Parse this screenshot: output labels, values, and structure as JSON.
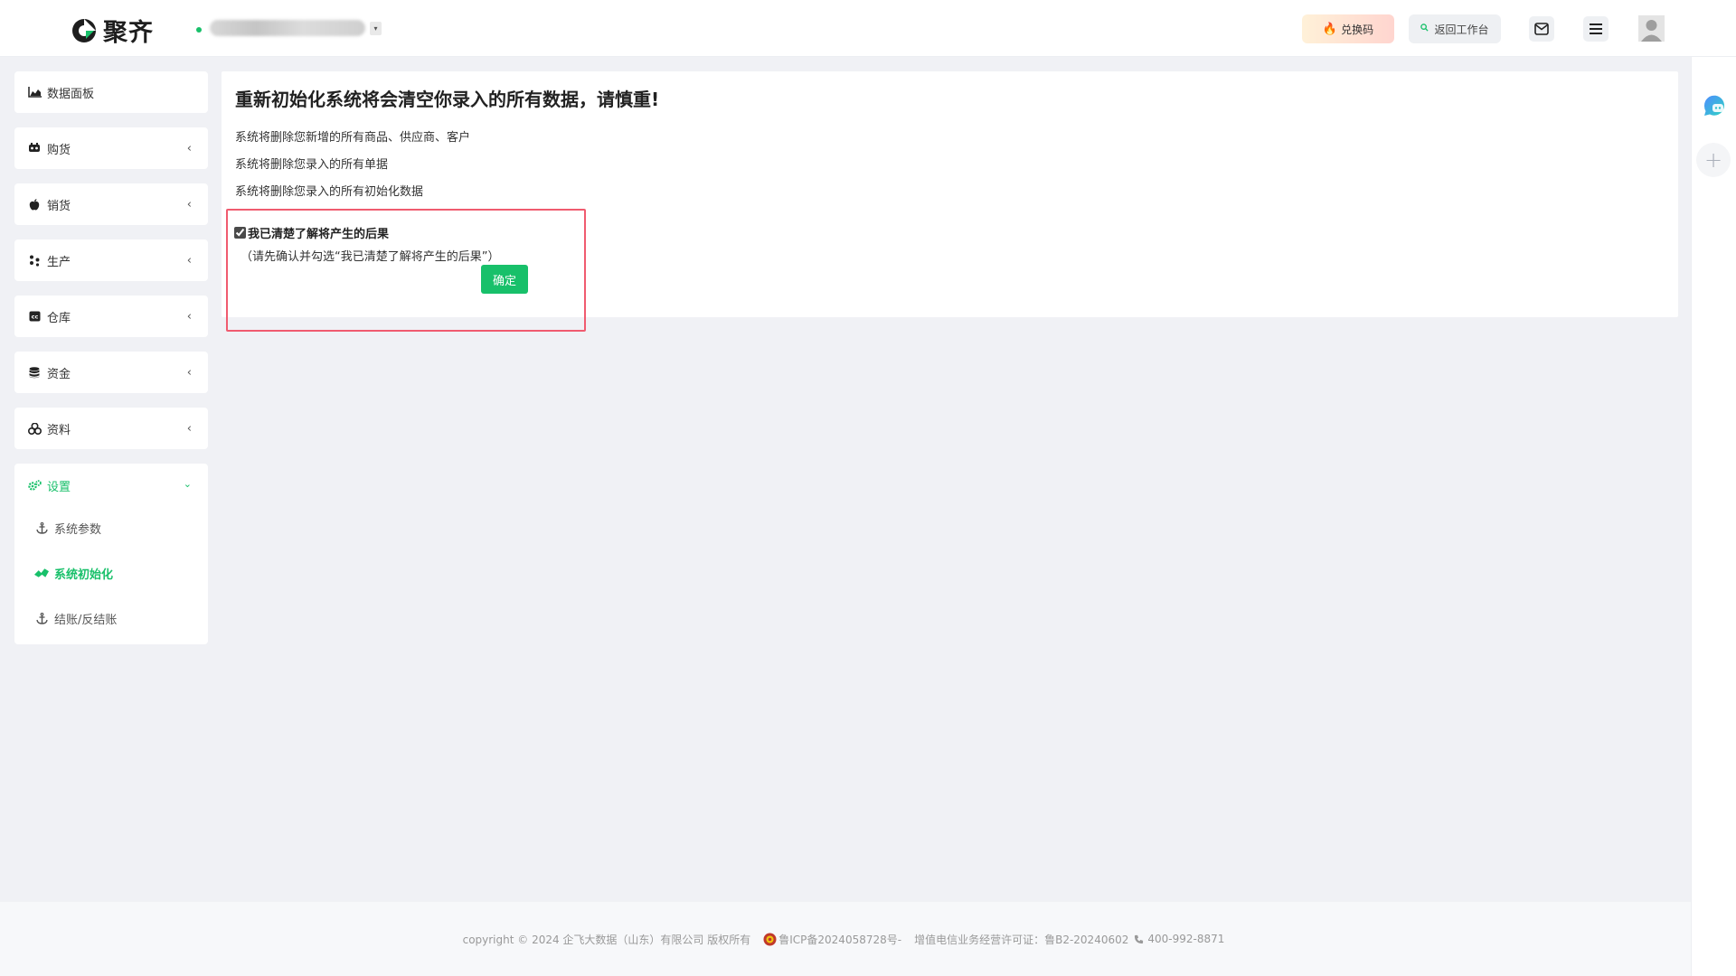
{
  "header": {
    "logo_text": "聚齐",
    "redeem_label": "兑换码",
    "workbench_label": "返回工作台"
  },
  "sidebar": {
    "items": [
      {
        "label": "数据面板",
        "icon": "chart-area-icon"
      },
      {
        "label": "购货",
        "icon": "cart-icon"
      },
      {
        "label": "销货",
        "icon": "apple-icon"
      },
      {
        "label": "生产",
        "icon": "cubes-icon"
      },
      {
        "label": "仓库",
        "icon": "warehouse-icon"
      },
      {
        "label": "资金",
        "icon": "database-icon"
      },
      {
        "label": "资料",
        "icon": "boxes-icon"
      }
    ],
    "settings": {
      "label": "设置",
      "sub_items": [
        {
          "label": "系统参数",
          "icon": "anchor-icon"
        },
        {
          "label": "系统初始化",
          "icon": "route-icon"
        },
        {
          "label": "结账/反结账",
          "icon": "anchor-icon"
        }
      ]
    }
  },
  "main": {
    "title": "重新初始化系统将会清空你录入的所有数据，请慎重!",
    "warnings": [
      "系统将删除您新增的所有商品、供应商、客户",
      "系统将删除您录入的所有单据",
      "系统将删除您录入的所有初始化数据"
    ],
    "agree_label": "我已清楚了解将产生的后果",
    "agree_checked": true,
    "agree_hint": "（请先确认并勾选“我已清楚了解将产生的后果”）",
    "confirm_label": "确定"
  },
  "footer": {
    "copyright": "copyright © 2024 企飞大数据（山东）有限公司 版权所有",
    "icp": "鲁ICP备2024058728号-",
    "license": "增值电信业务经营许可证：鲁B2-20240602",
    "phone": "400-992-8871"
  },
  "colors": {
    "accent": "#18c06a",
    "highlight_border": "#f05b6f",
    "background": "#f0f1f5"
  }
}
